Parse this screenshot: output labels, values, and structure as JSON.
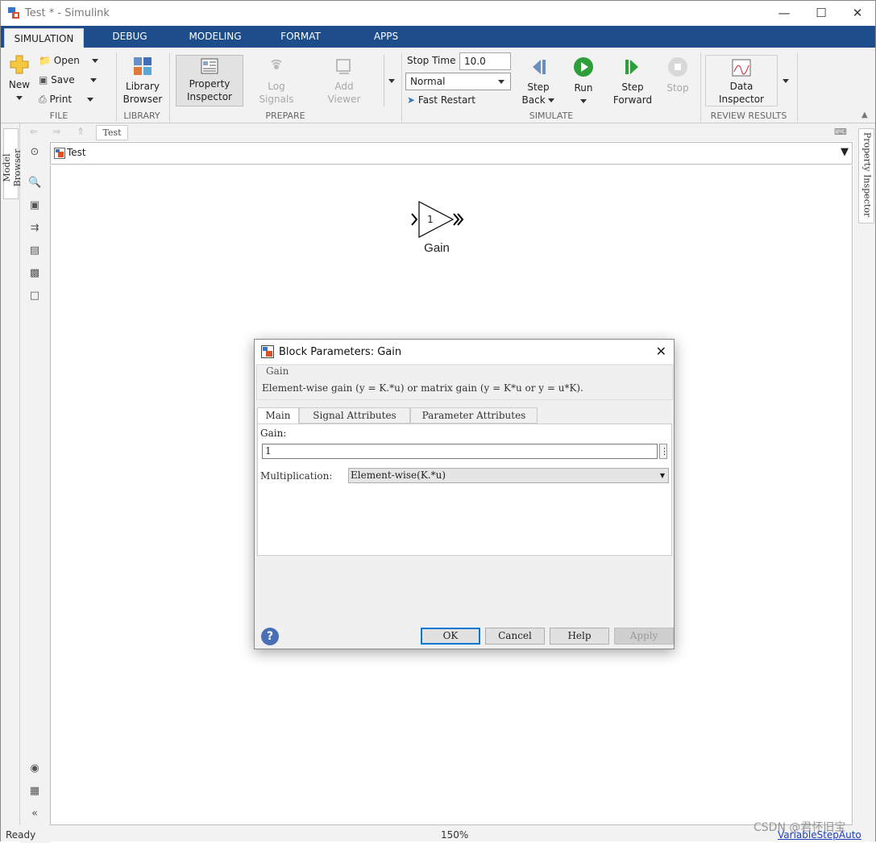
{
  "window": {
    "title": "Test * - Simulink"
  },
  "ribbon_tabs": [
    "SIMULATION",
    "DEBUG",
    "MODELING",
    "FORMAT",
    "APPS"
  ],
  "file": {
    "new": "New",
    "open": "Open",
    "save": "Save",
    "print": "Print",
    "section": "FILE"
  },
  "library": {
    "label_1": "Library",
    "label_2": "Browser",
    "section": "LIBRARY"
  },
  "prepare": {
    "prop_1": "Property",
    "prop_2": "Inspector",
    "log_1": "Log",
    "log_2": "Signals",
    "add_1": "Add",
    "add_2": "Viewer",
    "section": "PREPARE"
  },
  "simulate": {
    "stop_time_label": "Stop Time",
    "stop_time_value": "10.0",
    "mode": "Normal",
    "fast_restart": "Fast Restart",
    "step_back_1": "Step",
    "step_back_2": "Back",
    "run": "Run",
    "step_fwd_1": "Step",
    "step_fwd_2": "Forward",
    "stop": "Stop",
    "section": "SIMULATE"
  },
  "review": {
    "data_1": "Data",
    "data_2": "Inspector",
    "section": "REVIEW RESULTS"
  },
  "left_panel": {
    "model_browser": "Model Browser"
  },
  "right_panel": {
    "property_inspector": "Property Inspector"
  },
  "breadcrumb": "Test",
  "address": "Test",
  "block": {
    "value": "1",
    "name": "Gain"
  },
  "dialog": {
    "title": "Block Parameters: Gain",
    "group_title": "Gain",
    "description": "Element-wise gain (y = K.*u) or matrix gain (y = K*u or y = u*K).",
    "tabs": [
      "Main",
      "Signal Attributes",
      "Parameter Attributes"
    ],
    "gain_label": "Gain:",
    "gain_value": "1",
    "mult_label": "Multiplication:",
    "mult_value": "Element-wise(K.*u)",
    "buttons": {
      "ok": "OK",
      "cancel": "Cancel",
      "help": "Help",
      "apply": "Apply"
    }
  },
  "status": {
    "left": "Ready",
    "zoom": "150%",
    "solver": "VariableStepAuto",
    "watermark": "CSDN @君怀旧宝"
  },
  "colors": {
    "ribbon_tab_bg": "#1e4d8c",
    "run_green": "#2e9e3a",
    "accent": "#0078d7"
  }
}
